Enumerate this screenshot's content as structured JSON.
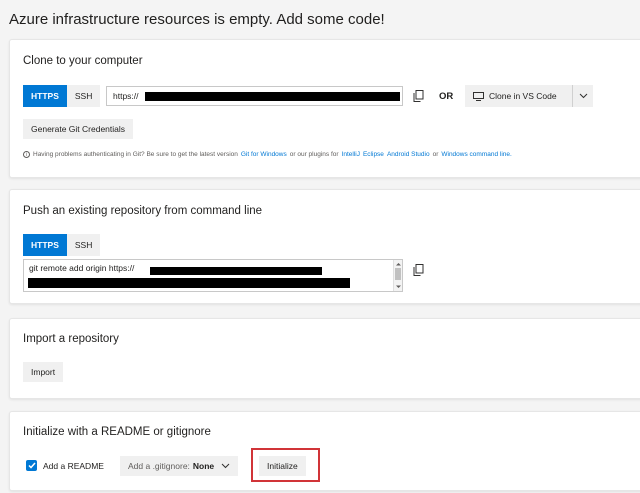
{
  "page": {
    "title": "Azure infrastructure resources is empty. Add some code!"
  },
  "clone": {
    "title": "Clone to your computer",
    "https_label": "HTTPS",
    "ssh_label": "SSH",
    "url_prefix": "https://",
    "or_label": "OR",
    "clone_vscode_label": "Clone in VS Code",
    "generate_credentials_label": "Generate Git Credentials",
    "help": {
      "prefix": "Having problems authenticating in Git? Be sure to get the latest version",
      "git_for_windows": "Git for Windows",
      "mid": "or our plugins for",
      "intellij": "IntelliJ",
      "eclipse": "Eclipse",
      "android_studio": "Android Studio",
      "or": "or",
      "windows_cmd": "Windows command line."
    }
  },
  "push": {
    "title": "Push an existing repository from command line",
    "https_label": "HTTPS",
    "ssh_label": "SSH",
    "command_prefix": "git remote add origin https://"
  },
  "import": {
    "title": "Import a repository",
    "import_label": "Import"
  },
  "init": {
    "title": "Initialize with a README or gitignore",
    "add_readme_label": "Add a README",
    "gitignore_prefix": "Add a .gitignore:",
    "gitignore_value": "None",
    "initialize_label": "Initialize",
    "add_readme_checked": true
  },
  "colors": {
    "accent": "#0078d4",
    "highlight": "#d13438"
  }
}
